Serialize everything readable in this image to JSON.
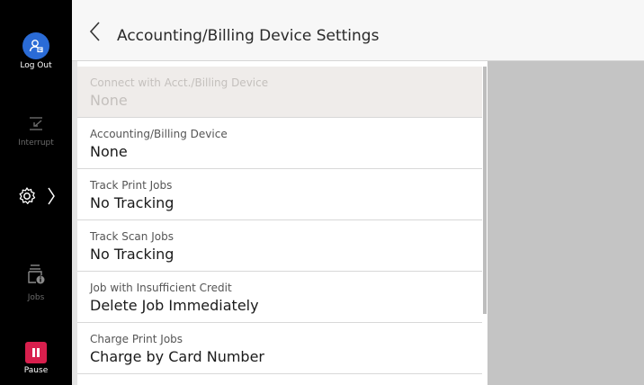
{
  "sidebar": {
    "logout_label": "Log Out",
    "interrupt_label": "Interrupt",
    "jobs_label": "Jobs",
    "pause_label": "Pause"
  },
  "header": {
    "title": "Accounting/Billing Device Settings"
  },
  "settings": [
    {
      "label": "Connect with Acct./Billing Device",
      "value": "None",
      "disabled": true
    },
    {
      "label": "Accounting/Billing Device",
      "value": "None",
      "disabled": false
    },
    {
      "label": "Track Print Jobs",
      "value": "No Tracking",
      "disabled": false
    },
    {
      "label": "Track Scan Jobs",
      "value": "No Tracking",
      "disabled": false
    },
    {
      "label": "Job with Insufficient Credit",
      "value": "Delete Job Immediately",
      "disabled": false
    },
    {
      "label": "Charge Print Jobs",
      "value": "Charge by Card Number",
      "disabled": false
    }
  ],
  "colors": {
    "logout_accent": "#2a6bd6",
    "pause_accent": "#d81f4d"
  },
  "icons": {
    "logout": "user-logout-icon",
    "interrupt": "interrupt-icon",
    "settings": "gear-icon",
    "jobs": "jobs-icon",
    "pause": "pause-icon",
    "back": "chevron-left-icon"
  }
}
